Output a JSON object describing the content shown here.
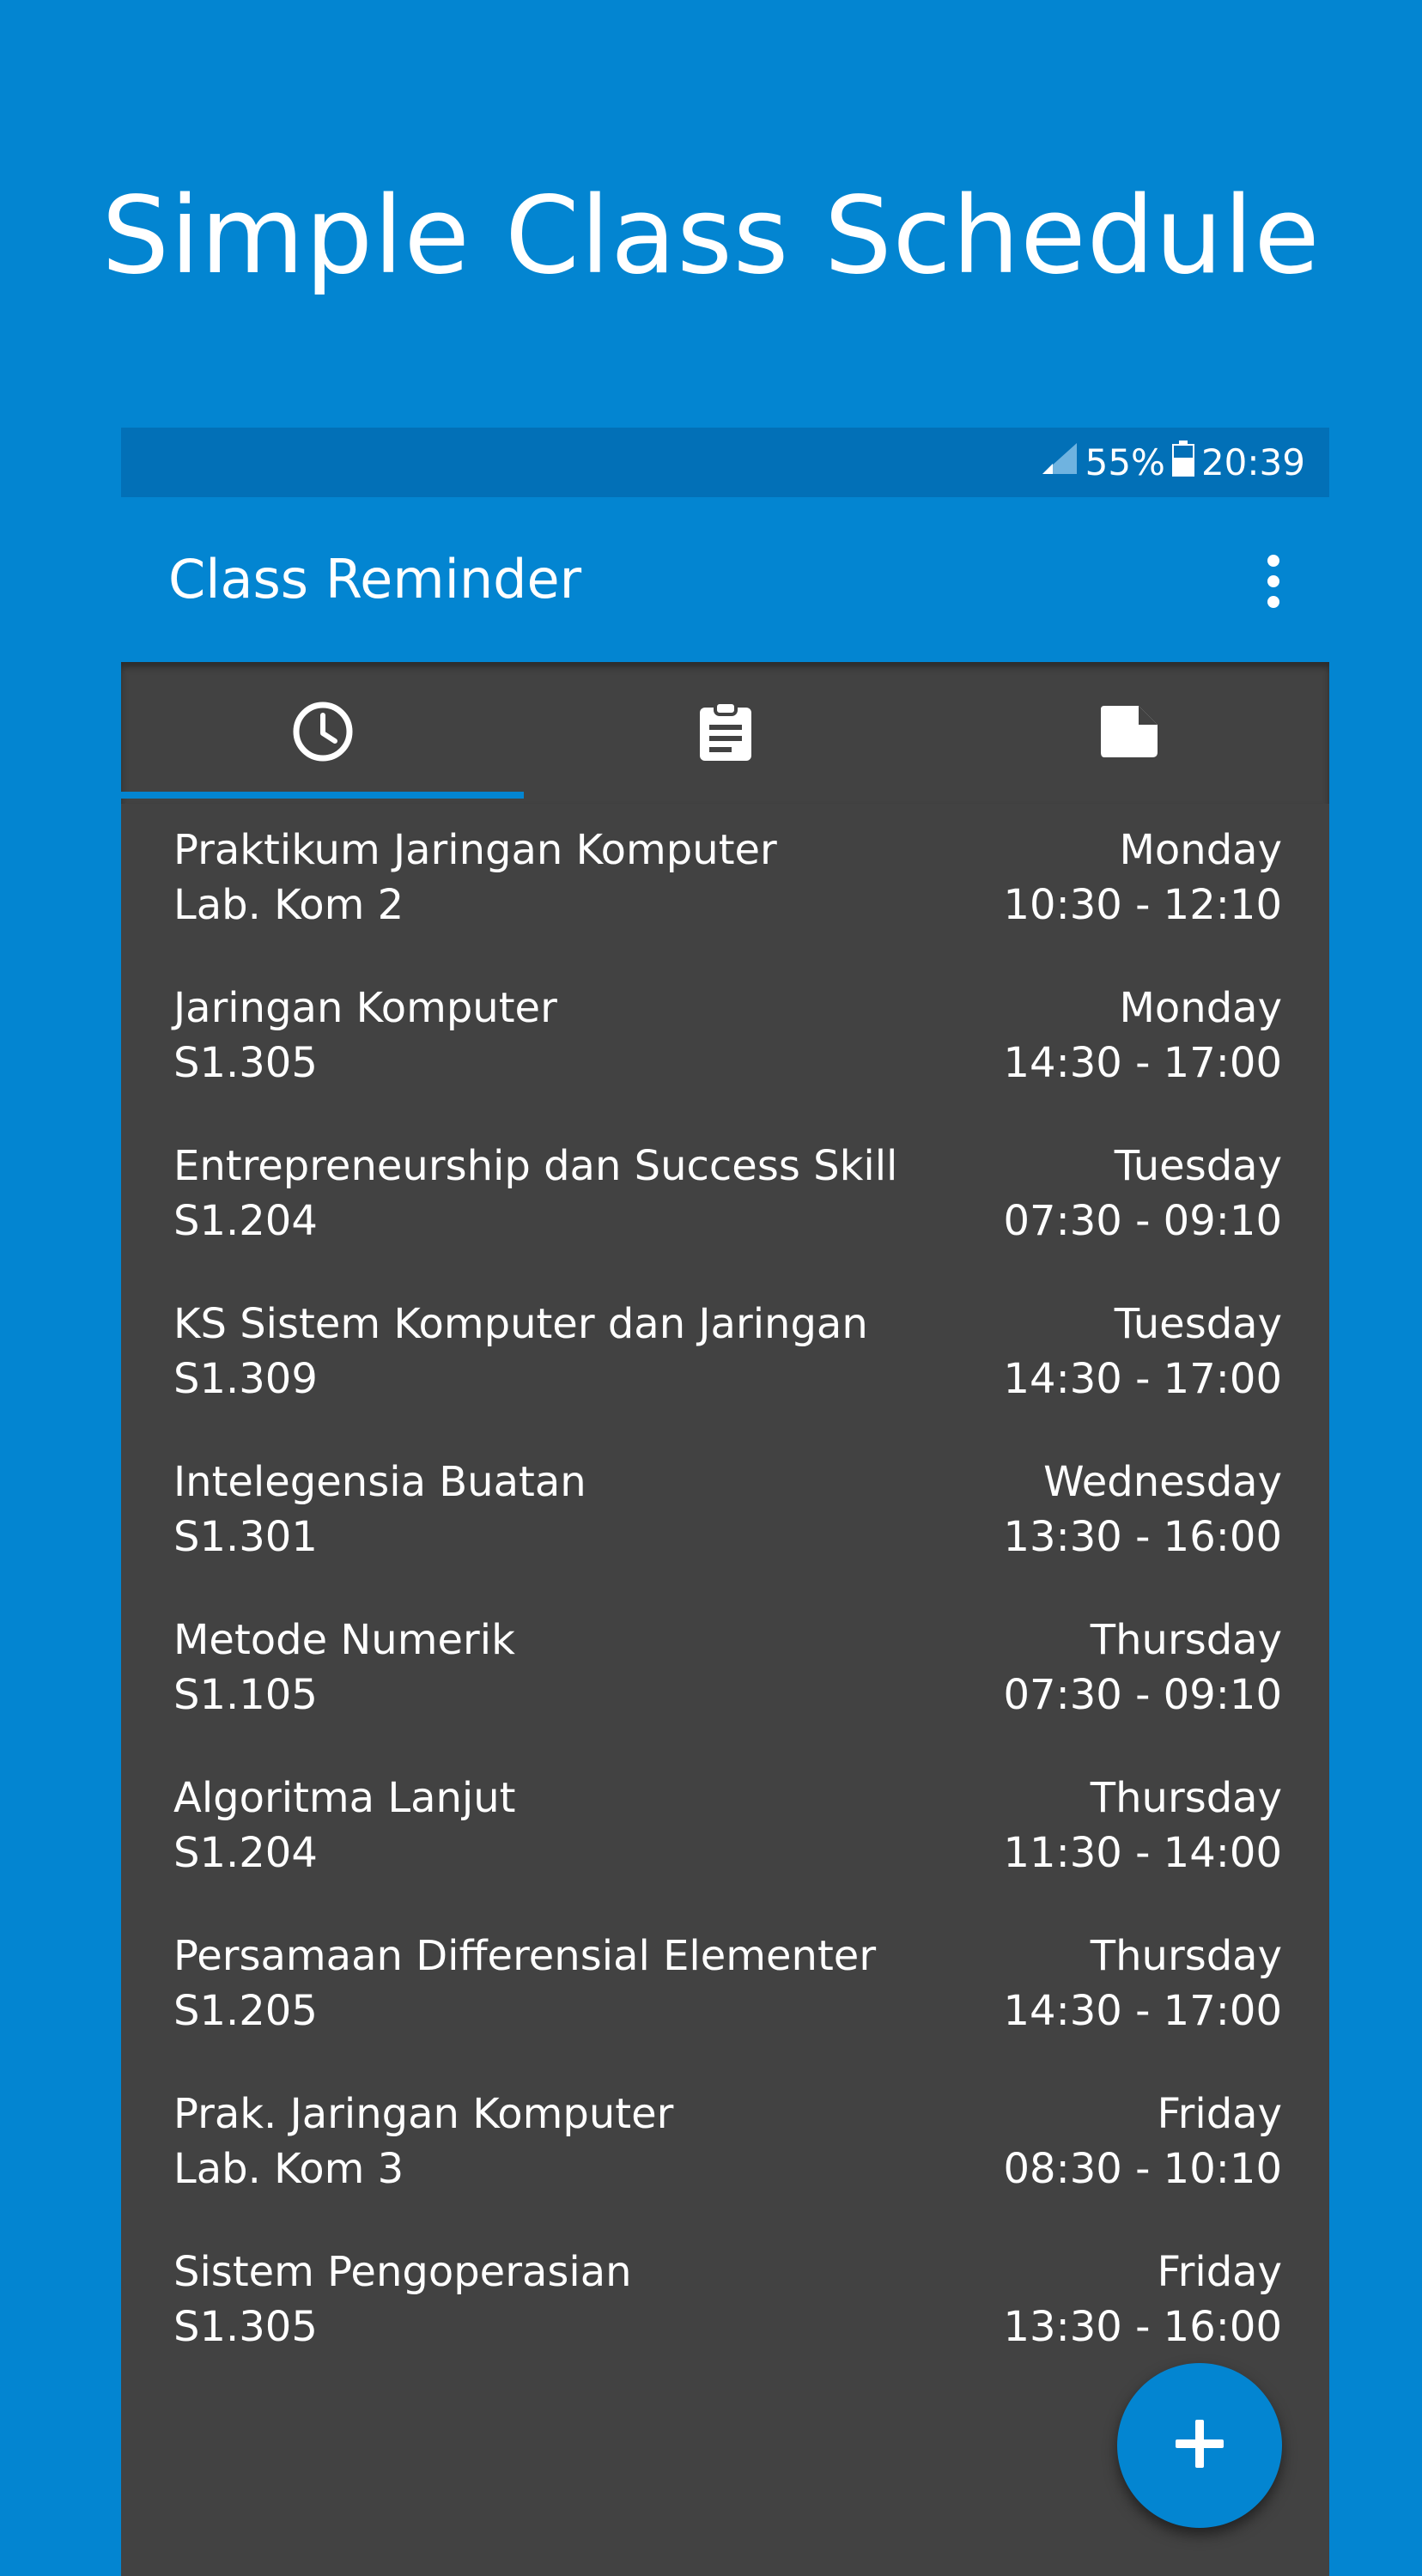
{
  "promo": {
    "title": "Simple Class Schedule"
  },
  "status_bar": {
    "battery": "55%",
    "time": "20:39"
  },
  "app_bar": {
    "title": "Class Reminder"
  },
  "tabs": [
    {
      "icon": "clock-icon",
      "selected": true
    },
    {
      "icon": "clipboard-icon",
      "selected": false
    },
    {
      "icon": "note-icon",
      "selected": false
    }
  ],
  "schedule": [
    {
      "course": "Praktikum Jaringan Komputer",
      "room": "Lab. Kom 2",
      "day": "Monday",
      "time": "10:30 - 12:10"
    },
    {
      "course": "Jaringan Komputer",
      "room": "S1.305",
      "day": "Monday",
      "time": "14:30 - 17:00"
    },
    {
      "course": "Entrepreneurship dan Success Skill",
      "room": "S1.204",
      "day": "Tuesday",
      "time": "07:30 - 09:10"
    },
    {
      "course": "KS Sistem Komputer dan Jaringan",
      "room": "S1.309",
      "day": "Tuesday",
      "time": "14:30 - 17:00"
    },
    {
      "course": "Intelegensia Buatan",
      "room": "S1.301",
      "day": "Wednesday",
      "time": "13:30 - 16:00"
    },
    {
      "course": "Metode Numerik",
      "room": "S1.105",
      "day": "Thursday",
      "time": "07:30 - 09:10"
    },
    {
      "course": "Algoritma Lanjut",
      "room": "S1.204",
      "day": "Thursday",
      "time": "11:30 - 14:00"
    },
    {
      "course": "Persamaan Differensial Elementer",
      "room": "S1.205",
      "day": "Thursday",
      "time": "14:30 - 17:00"
    },
    {
      "course": "Prak. Jaringan Komputer",
      "room": "Lab. Kom 3",
      "day": "Friday",
      "time": "08:30 - 10:10"
    },
    {
      "course": "Sistem Pengoperasian",
      "room": "S1.305",
      "day": "Friday",
      "time": "13:30 - 16:00"
    }
  ],
  "fab": {
    "icon": "plus-icon"
  },
  "colors": {
    "primary": "#0385d1",
    "primary_dark": "#0270b7",
    "list_background": "#424242",
    "text": "#ffffff"
  }
}
